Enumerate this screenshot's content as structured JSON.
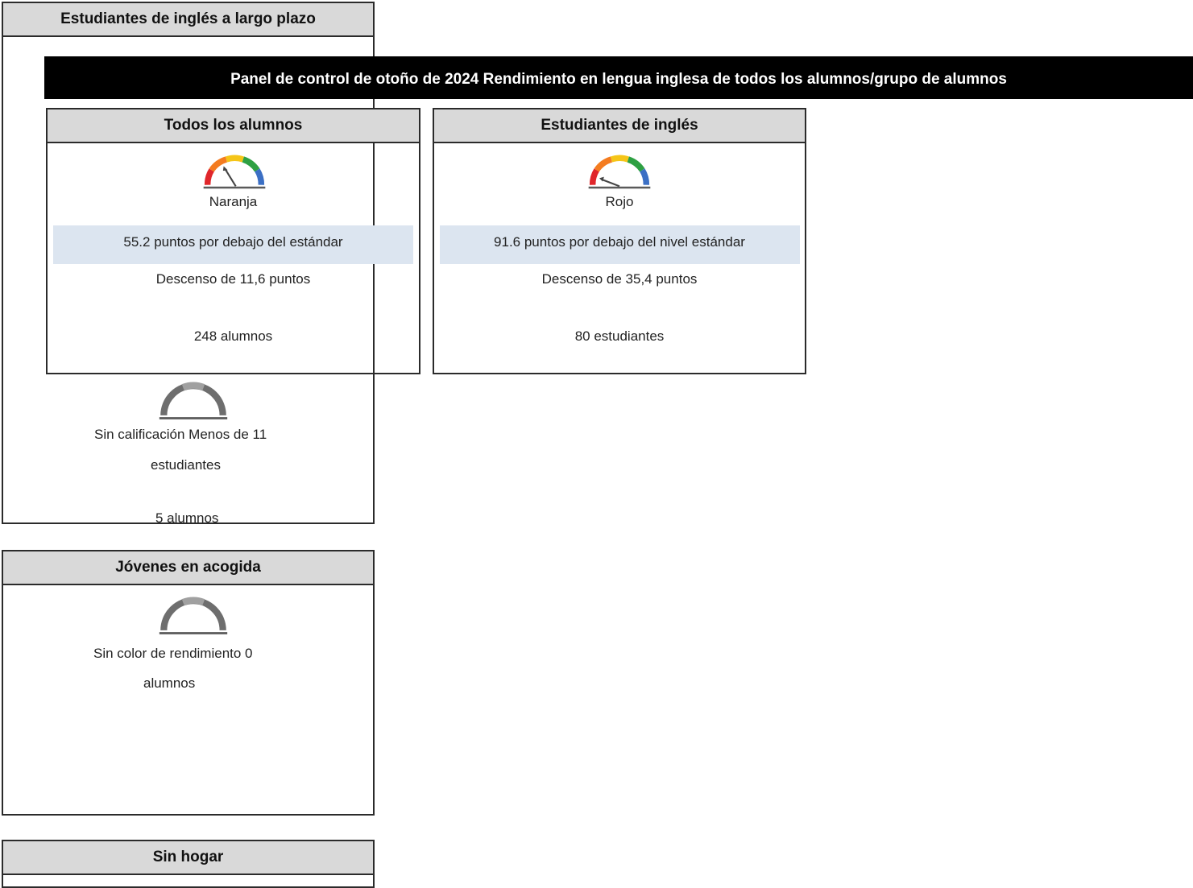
{
  "banner": {
    "title": "Panel de control de otoño de 2024 Rendimiento en lengua inglesa de todos los alumnos/grupo de alumnos"
  },
  "long_term_el": {
    "title": "Estudiantes de inglés a largo plazo",
    "status_line1": "Sin calificación Menos de 11",
    "status_line2": "estudiantes",
    "count": "5 alumnos"
  },
  "all_students": {
    "title": "Todos los alumnos",
    "color": "Naranja",
    "distance": "55.2 puntos por debajo del estándar",
    "change": "Descenso de 11,6 puntos",
    "count": "248 alumnos"
  },
  "english_learners": {
    "title": "Estudiantes de inglés",
    "color": "Rojo",
    "distance": "91.6 puntos por debajo del nivel estándar",
    "change": "Descenso de 35,4 puntos",
    "count": "80 estudiantes"
  },
  "foster_youth": {
    "title": "Jóvenes en acogida",
    "status_line1": "Sin color de rendimiento 0",
    "status_line2": "alumnos"
  },
  "homeless": {
    "title": "Sin hogar"
  },
  "colors": {
    "red": "#e0262b",
    "orange": "#f47c20",
    "yellow": "#f5c518",
    "green": "#2ea043",
    "blue": "#3b6fc4",
    "gray": "#6e6e6e",
    "band": "#dce5f0"
  }
}
